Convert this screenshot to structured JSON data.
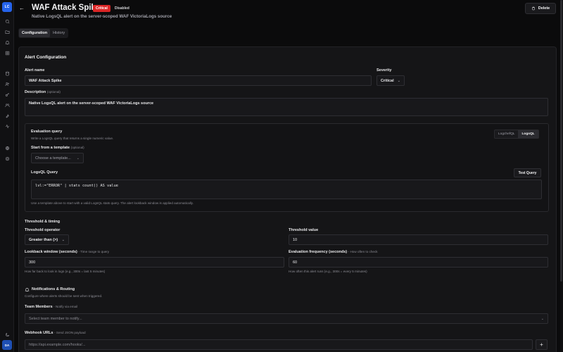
{
  "sidebar": {
    "logo": "LC",
    "avatar": "DA",
    "icons": [
      "search-icon",
      "folder-icon",
      "bell-icon",
      "grid-icon",
      "database-icon",
      "users-icon",
      "key-icon",
      "team-icon",
      "wrench-icon",
      "activity-icon",
      "globe-icon",
      "settings-icon",
      "moon-icon"
    ]
  },
  "header": {
    "title": "WAF Attack Spike",
    "severity_badge": "Critical",
    "status_badge": "Disabled",
    "subtitle": "Native LogsQL alert on the server-scoped WAF VictoriaLogs source",
    "delete_label": "Delete"
  },
  "tabs": [
    {
      "label": "Configuration",
      "active": true
    },
    {
      "label": "History",
      "active": false
    }
  ],
  "config": {
    "section_title": "Alert Configuration",
    "alert_name_label": "Alert name",
    "alert_name_value": "WAF Attack Spike",
    "severity_label": "Severity",
    "severity_value": "Critical",
    "description_label": "Description",
    "description_hint": "(optional)",
    "description_value": "Native LogsQL alert on the server-scoped WAF VictoriaLogs source"
  },
  "evaluation": {
    "title": "Evaluation query",
    "subtitle": "Write a LogsQL query that returns a single numeric value.",
    "toggle": [
      {
        "label": "LogchefQL",
        "active": false
      },
      {
        "label": "LogsQL",
        "active": true
      }
    ],
    "template_label": "Start from a template",
    "template_hint": "(optional)",
    "template_placeholder": "Choose a template...",
    "query_label": "LogsQL Query",
    "test_button": "Test Query",
    "query_value": "lvl:=\"ERROR\" | stats count() AS value",
    "help": "Use a template above to start with a valid LogsQL stats query. The alert lookback window is applied automatically."
  },
  "threshold": {
    "section_title": "Threshold & timing",
    "operator_label": "Threshold operator",
    "operator_value": "Greater than (>)",
    "value_label": "Threshold value",
    "value": "10",
    "lookback_label": "Lookback window (seconds)",
    "lookback_hint": "- Time range to query",
    "lookback_value": "300",
    "lookback_help": "How far back to look in logs (e.g., 300s = last 5 minutes)",
    "frequency_label": "Evaluation frequency (seconds)",
    "frequency_hint": "- How often to check",
    "frequency_value": "60",
    "frequency_help": "How often this alert runs (e.g., 300s = every 5 minutes)"
  },
  "notifications": {
    "title": "Notifications & Routing",
    "subtitle": "Configure where alerts should be sent when triggered.",
    "team_label": "Team Members",
    "team_hint": "- Notify via email",
    "team_placeholder": "Select team member to notify...",
    "webhook_label": "Webhook URLs",
    "webhook_hint": "- Send JSON payload",
    "webhook_placeholder": "https://api.example.com/hooks/...",
    "add_label": "+"
  }
}
